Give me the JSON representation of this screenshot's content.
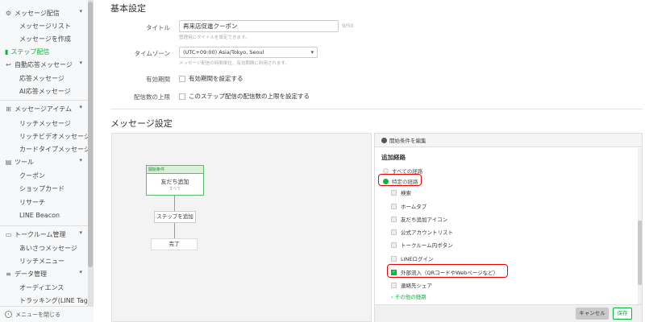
{
  "sidebar": {
    "sections": [
      {
        "label": "メッセージ配信",
        "icon": "gear-icon"
      },
      {
        "label": "自動応答メッセージ",
        "icon": "reply-icon"
      },
      {
        "label": "メッセージアイテム",
        "icon": "message-item-icon"
      },
      {
        "label": "ツール",
        "icon": "toolbox-icon"
      },
      {
        "label": "トークルーム管理",
        "icon": "talk-room-icon"
      },
      {
        "label": "データ管理",
        "icon": "database-icon"
      }
    ],
    "items": {
      "message_list": "メッセージリスト",
      "create_message": "メッセージを作成",
      "step_delivery": "ステップ配信",
      "auto_reply": "応答メッセージ",
      "ai_reply": "AI応答メッセージ",
      "rich_message": "リッチメッセージ",
      "rich_video": "リッチビデオメッセージ",
      "card_type": "カードタイプメッセージ",
      "coupon": "クーポン",
      "shop_card": "ショップカード",
      "research": "リサーチ",
      "line_beacon": "LINE Beacon",
      "greeting": "あいさつメッセージ",
      "rich_menu": "リッチメニュー",
      "audience": "オーディエンス",
      "tracking": "トラッキング(LINE Tag)"
    },
    "footer": "メニューを閉じる"
  },
  "basic": {
    "heading": "基本設定",
    "title_label": "タイトル",
    "title_value": "再来店促進クーポン",
    "title_counter": "9/50",
    "title_hint": "管理用にタイトルを設定できます。",
    "timezone_label": "タイムゾーン",
    "timezone_value": "(UTC+09:00) Asia/Tokyo, Seoul",
    "timezone_hint": "メッセージ配信の時間単位、有効期間に利用されます。",
    "period_label": "有効期間",
    "period_option": "有効期間を設定する",
    "limit_label": "配信数の上限",
    "limit_option": "このステップ配信の配信数の上限を設定する"
  },
  "message": {
    "heading": "メッセージ設定",
    "start_node_header": "開始条件",
    "start_node_title": "友だち追加",
    "start_node_sub": "すべて",
    "add_step": "ステップを追加",
    "end_node": "完了"
  },
  "panel": {
    "edit_label": "開始条件を編集",
    "subheading": "追加経路",
    "route_all": "すべての経路",
    "route_specific": "特定の経路",
    "sources": [
      {
        "label": "検索",
        "checked": false
      },
      {
        "label": "ホームタブ",
        "checked": false
      },
      {
        "label": "友だち追加アイコン",
        "checked": false
      },
      {
        "label": "公式アカウントリスト",
        "checked": false
      },
      {
        "label": "トークルーム内ボタン",
        "checked": false
      },
      {
        "label": "LINEログイン",
        "checked": false
      },
      {
        "label": "外部流入（QRコードやWebページなど）",
        "checked": true
      },
      {
        "label": "連絡先シェア",
        "checked": false
      }
    ],
    "more": "その他の経路",
    "cancel": "キャンセル",
    "save": "保存"
  },
  "colors": {
    "accent": "#06b83a",
    "highlight": "#e00000"
  }
}
